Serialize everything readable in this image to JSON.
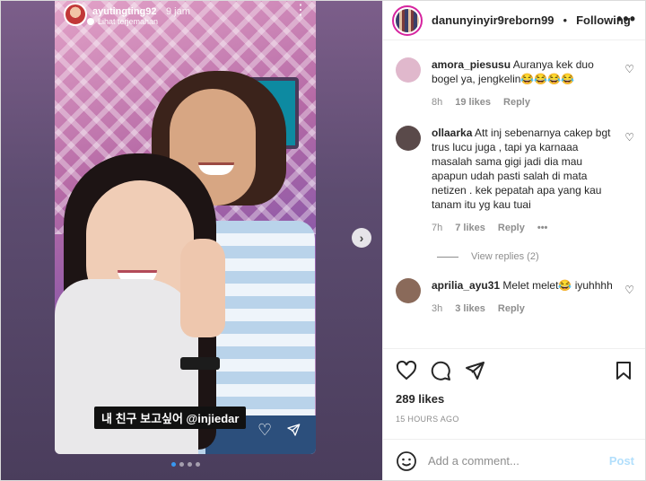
{
  "story": {
    "username": "ayutingting92",
    "time": "9 jam",
    "translate_label": "Lihat terjemahan",
    "more_icon": "more-vertical-icon",
    "caption": "내 친구 보고싶어 @injiedar",
    "pager_total": 4,
    "pager_active": 1
  },
  "post_header": {
    "username": "danunyinyir9reborn99",
    "separator": "•",
    "follow_label": "Following",
    "more_label": "•••"
  },
  "comments": [
    {
      "username": "amora_piesusu",
      "text": "Auranya kek duo bogel ya, jengkelin😂😂😂😂",
      "time": "8h",
      "likes": "19 likes",
      "reply": "Reply",
      "avatar_color": "#d9a7c0"
    },
    {
      "username": "ollaarka",
      "text": "Att inj sebenarnya cakep bgt trus lucu juga , tapi ya karnaaa masalah sama gigi jadi dia mau apapun udah pasti salah di mata netizen . kek pepatah apa yang kau tanam itu yg kau tuai",
      "time": "7h",
      "likes": "7 likes",
      "reply": "Reply",
      "more": "•••",
      "avatar_color": "#5a4a4a",
      "view_replies": "View replies (2)"
    },
    {
      "username": "aprilia_ayu31",
      "text": "Melet melet😂 iyuhhhh",
      "time": "3h",
      "likes": "3 likes",
      "reply": "Reply",
      "avatar_color": "#8a6a5a"
    }
  ],
  "actions": {
    "likes": "289 likes",
    "timestamp": "15 HOURS AGO"
  },
  "add_comment": {
    "placeholder": "Add a comment...",
    "post_label": "Post",
    "emoji_icon": "smiley-icon"
  },
  "colors": {
    "accent": "#3897f0",
    "post_disabled": "#b2dffc",
    "muted": "#8e8e8e"
  }
}
